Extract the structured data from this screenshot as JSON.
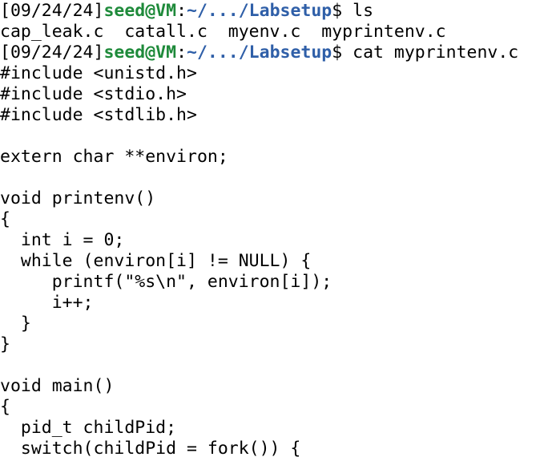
{
  "terminal": {
    "prompt_date": "[09/24/24]",
    "prompt_user_host": "seed@VM",
    "prompt_colon": ":",
    "prompt_path": "~/.../Labsetup",
    "prompt_dollar": "$ ",
    "commands": [
      "ls",
      "cat myprintenv.c"
    ],
    "ls_output": "cap_leak.c  catall.c  myenv.c  myprintenv.c",
    "file_lines": [
      "#include <unistd.h>",
      "#include <stdio.h>",
      "#include <stdlib.h>",
      "",
      "extern char **environ;",
      "",
      "void printenv()",
      "{",
      "  int i = 0;",
      "  while (environ[i] != NULL) {",
      "     printf(\"%s\\n\", environ[i]);",
      "     i++;",
      "  }",
      "}",
      "",
      "void main()",
      "{",
      "  pid_t childPid;",
      "  switch(childPid = fork()) {"
    ],
    "colors": {
      "user_host": "#1e8a3a",
      "path": "#2f5fa8",
      "text": "#000000",
      "background": "#ffffff"
    }
  }
}
